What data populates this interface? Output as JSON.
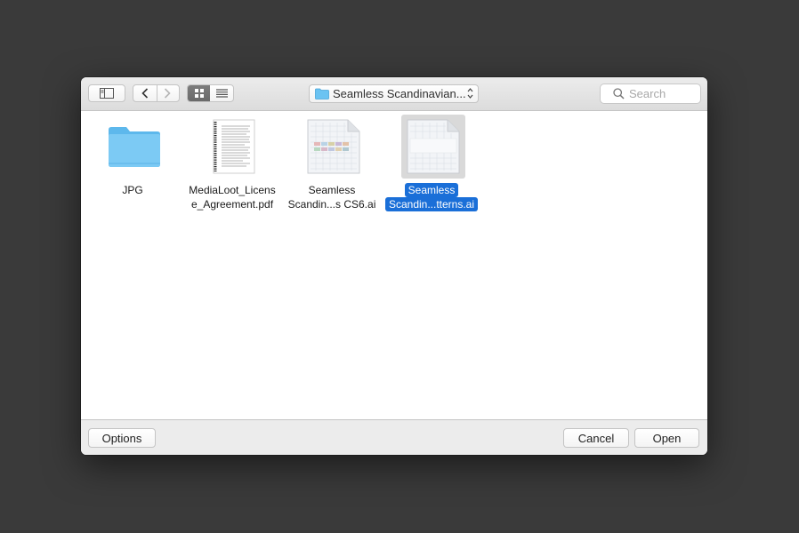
{
  "toolbar": {
    "sidebar_toggle_icon": "sidebar-icon",
    "back_icon": "chevron-left-icon",
    "forward_icon": "chevron-right-icon",
    "view_modes": [
      "icon-view",
      "list-view"
    ],
    "active_view": "icon-view",
    "location_label": "Seamless Scandinavian...",
    "location_icon": "folder-icon",
    "search_placeholder": "Search"
  },
  "files": [
    {
      "name_line1": "JPG",
      "name_line2": "",
      "type": "folder",
      "selected": false
    },
    {
      "name_line1": "MediaLoot_Licens",
      "name_line2": "e_Agreement.pdf",
      "type": "pdf",
      "selected": false
    },
    {
      "name_line1": "Seamless",
      "name_line2": "Scandin...s CS6.ai",
      "type": "ai",
      "selected": false
    },
    {
      "name_line1": "Seamless",
      "name_line2": "Scandin...tterns.ai",
      "type": "ai",
      "selected": true
    }
  ],
  "footer": {
    "options_label": "Options",
    "cancel_label": "Cancel",
    "open_label": "Open"
  },
  "colors": {
    "selection": "#1a6fd8",
    "folder": "#6bc3f2",
    "backdrop": "#3a3a3a"
  }
}
